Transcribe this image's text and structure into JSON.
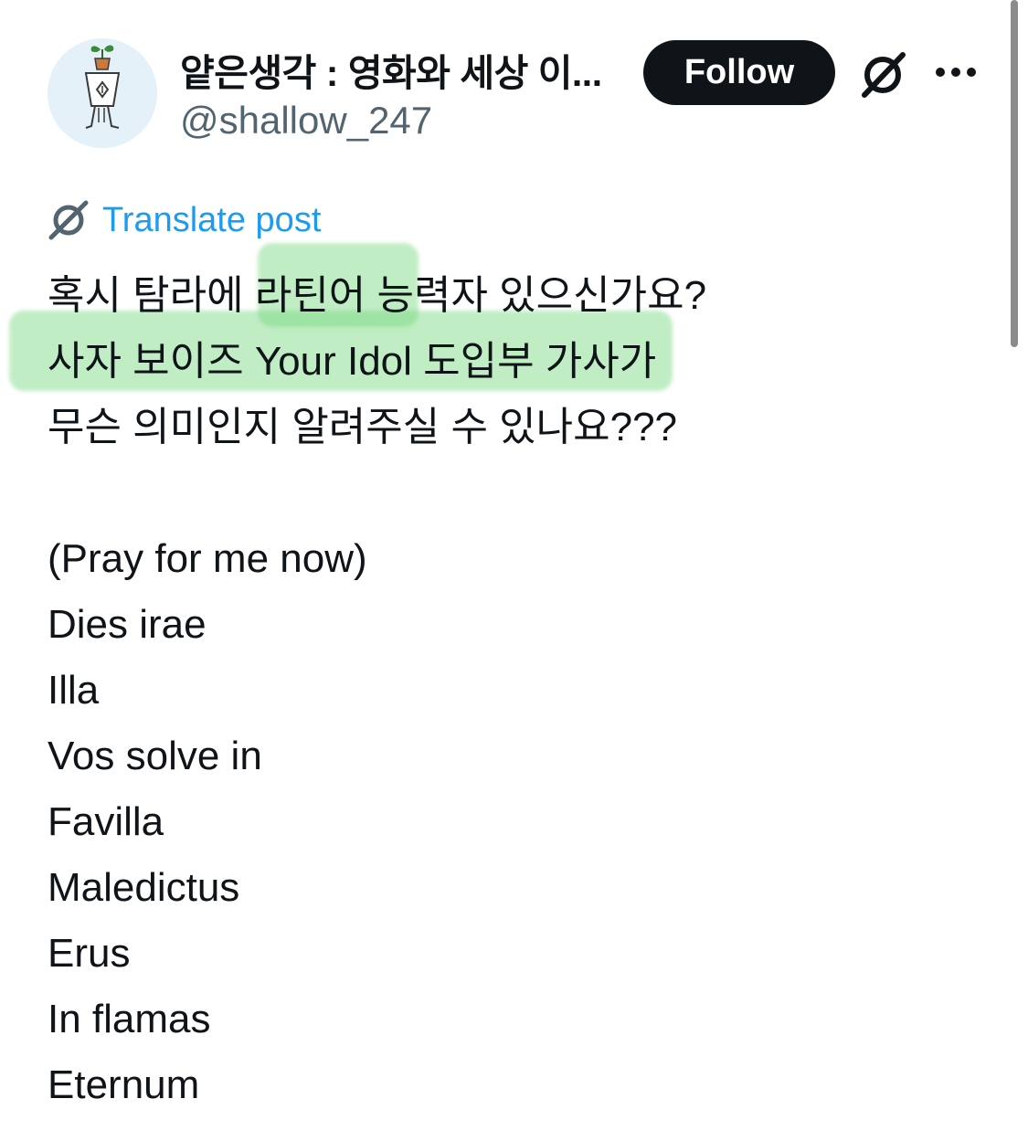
{
  "user": {
    "display_name": "얕은생각 : 영화와 세상 이...",
    "handle": "@shallow_247",
    "avatar_icon": "plant-robot-avatar"
  },
  "actions": {
    "follow_label": "Follow",
    "grok_icon": "grok-icon",
    "more_icon": "more-icon"
  },
  "translate": {
    "label": "Translate post",
    "icon": "grok-icon"
  },
  "post": {
    "lines": [
      "혹시 탐라에 라틴어 능력자 있으신가요?",
      "사자 보이즈 Your Idol 도입부 가사가",
      "무슨 의미인지 알려주실 수 있나요???",
      "",
      "(Pray for me now)",
      "Dies irae",
      "Illa",
      "Vos solve in",
      "Favilla",
      "Maledictus",
      "Erus",
      "In flamas",
      "Eternum"
    ]
  },
  "colors": {
    "text": "#0f1419",
    "muted": "#536471",
    "link": "#1d9bf0",
    "button_bg": "#0f1419",
    "highlight": "#74d67c"
  }
}
